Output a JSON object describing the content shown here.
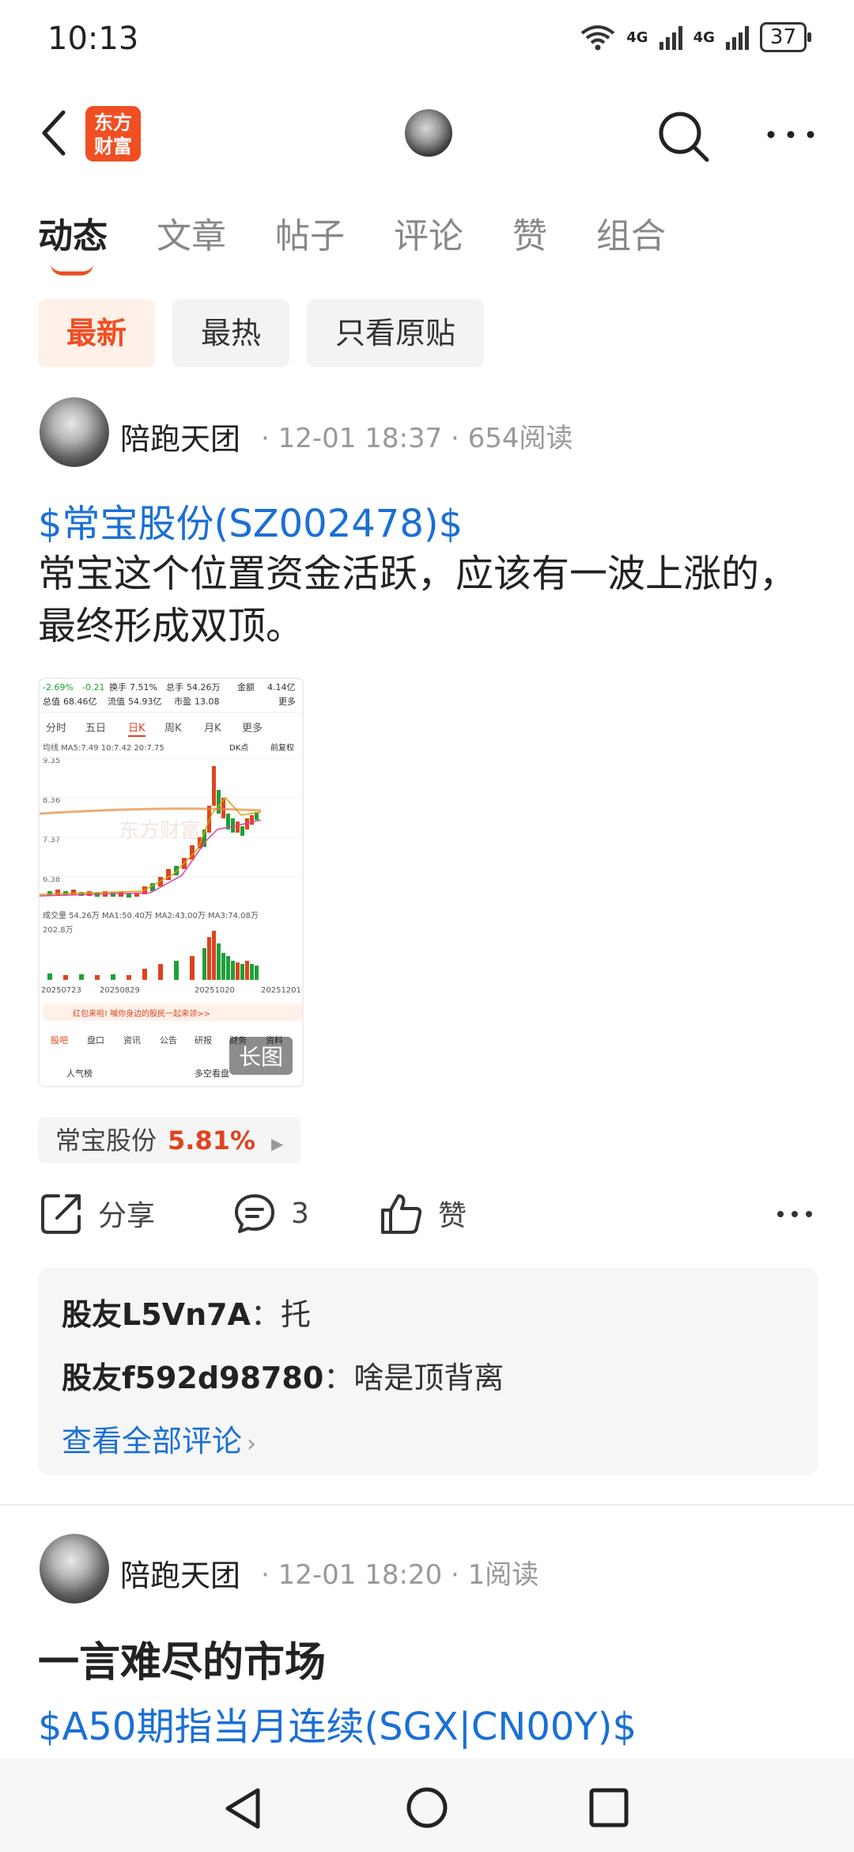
{
  "status_bar": {
    "time": "10:13",
    "network1": "4G",
    "network2": "4G",
    "battery": "37"
  },
  "header": {
    "logo_line1": "东方",
    "logo_line2": "财富"
  },
  "tabs": [
    {
      "label": "动态",
      "active": true
    },
    {
      "label": "文章"
    },
    {
      "label": "帖子"
    },
    {
      "label": "评论"
    },
    {
      "label": "赞"
    },
    {
      "label": "组合"
    }
  ],
  "filters": [
    {
      "label": "最新",
      "active": true
    },
    {
      "label": "最热"
    },
    {
      "label": "只看原贴"
    }
  ],
  "post1": {
    "author": "陪跑天团",
    "time": "12-01 18:37",
    "reads": "654阅读",
    "stock_link": "$常宝股份(SZ002478)$",
    "text": "常宝这个位置资金活跃，应该有一波上涨的，最终形成双顶。",
    "image_badge": "长图",
    "stock_tag": {
      "name": "常宝股份",
      "pct": "5.81%"
    },
    "actions": {
      "share": "分享",
      "comment_count": "3",
      "like": "赞"
    },
    "comments": [
      {
        "user": "股友L5Vn7A",
        "text": "托"
      },
      {
        "user": "股友f592d98780",
        "text": "啥是顶背离"
      }
    ],
    "view_all": "查看全部评论"
  },
  "post2": {
    "author": "陪跑天团",
    "time": "12-01 18:20",
    "reads": "1阅读",
    "title": "一言难尽的市场",
    "stock_link": "$A50期指当月连续(SGX|CN00Y)$"
  },
  "thumbnail": {
    "change": "-2.69%",
    "change_abs": "-0.21",
    "turnover_label": "换手",
    "turnover": "7.51%",
    "volume_label": "总手",
    "volume": "54.26万",
    "amount_label": "金额",
    "amount": "4.14亿",
    "cap_label": "总值",
    "cap": "68.46亿",
    "float_label": "流值",
    "float_cap": "54.93亿",
    "pe_label": "市盈",
    "pe": "13.08",
    "more": "更多",
    "periods": [
      "分时",
      "五日",
      "日K",
      "周K",
      "月K",
      "更多"
    ],
    "ma_line": "均线 MA5:7.49 10:7.42 20:7.75",
    "dk": "DK点",
    "adj": "前复权",
    "prices": [
      "9.35",
      "8.36",
      "7.37",
      "6.38"
    ],
    "watermark": "东方财富",
    "vol_line": "成交量 54.26万 MA1:50.40万 MA2:43.00万 MA3:74.08万",
    "vol_max": "202.8万",
    "dates": [
      "20250723",
      "20250829",
      "20251020",
      "20251201"
    ],
    "banner": "红包来啦! 喊你身边的股民一起来领>>",
    "bottom_tabs": [
      "股吧",
      "盘口",
      "资讯",
      "公告",
      "研报",
      "财务",
      "资料"
    ],
    "bottom_left": "人气榜",
    "bottom_right": "多空看盘"
  },
  "colors": {
    "accent": "#f04e23",
    "link": "#1a6fd6",
    "up": "#e0431f",
    "down": "#1f9e3a"
  }
}
